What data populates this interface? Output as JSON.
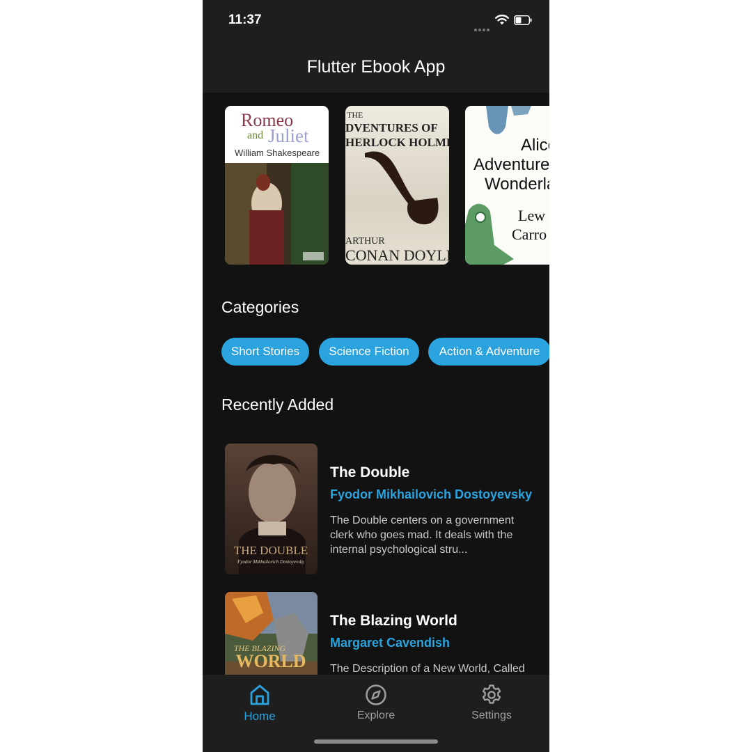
{
  "status": {
    "time": "11:37"
  },
  "app": {
    "title": "Flutter Ebook App"
  },
  "featured": [
    {
      "name": "romeo-and-juliet-cover",
      "line1": "Romeo",
      "line2a": "and",
      "line2b": "Juliet",
      "author": "William Shakespeare"
    },
    {
      "name": "sherlock-holmes-cover",
      "top": "THE",
      "line1": "DVENTURES OF",
      "line2": "HERLOCK HOLME",
      "author1": "ARTHUR",
      "author2": "CONAN DOYLE"
    },
    {
      "name": "alice-cover",
      "line1": "Alice",
      "line2": "Adventures",
      "line3": "Wonderlan",
      "author1": "Lew",
      "author2": "Carro"
    }
  ],
  "categories": {
    "title": "Categories",
    "items": [
      "Short Stories",
      "Science Fiction",
      "Action & Adventure"
    ]
  },
  "recent": {
    "title": "Recently Added",
    "books": [
      {
        "title": "The Double",
        "author": "Fyodor Mikhailovich Dostoyevsky",
        "description": "The Double centers on a government clerk who goes mad. It deals with the internal psychological stru...",
        "cover_title": "THE DOUBLE",
        "cover_author": "Fyodor Mikhailovich Dostoyevsky"
      },
      {
        "title": "The Blazing World",
        "author": "Margaret Cavendish",
        "description": "The Description of a New World, Called",
        "cover_title1": "THE BLAZING",
        "cover_title2": "WORLD"
      }
    ]
  },
  "nav": {
    "items": [
      {
        "label": "Home",
        "icon": "home-icon",
        "active": true
      },
      {
        "label": "Explore",
        "icon": "compass-icon",
        "active": false
      },
      {
        "label": "Settings",
        "icon": "gear-icon",
        "active": false
      }
    ],
    "active_color": "#2aa3df",
    "inactive_color": "#9e9e9e"
  },
  "colors": {
    "accent": "#2aa3df",
    "background": "#121212",
    "surface": "#1e1e1e"
  }
}
